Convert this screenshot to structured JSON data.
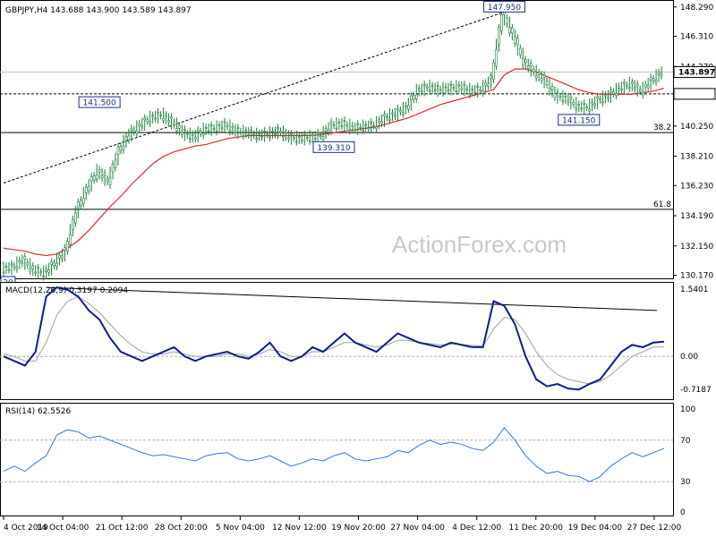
{
  "chart_data": [
    {
      "type": "candlestick",
      "title": "GBPJPY,H4 143.688 143.900 143.589 143.897",
      "watermark": "ActionForex.com",
      "current_price": "143.897",
      "current_price_value": 143.897,
      "ylim": [
        129.9,
        148.7
      ],
      "yticks": [
        "148.290",
        "146.310",
        "144.270",
        "142.420",
        "140.250",
        "138.210",
        "136.230",
        "134.190",
        "132.150",
        "130.170"
      ],
      "ytick_values": [
        148.29,
        146.31,
        144.27,
        142.42,
        140.25,
        138.21,
        136.23,
        134.19,
        132.15,
        130.17
      ],
      "xticks": [
        "4 Oct 2019",
        "14 Oct 04:00",
        "21 Oct 12:00",
        "28 Oct 20:00",
        "5 Nov 04:00",
        "12 Nov 12:00",
        "19 Nov 20:00",
        "27 Nov 04:00",
        "4 Dec 12:00",
        "11 Dec 20:00",
        "19 Dec 04:00",
        "27 Dec 12:00"
      ],
      "ma_color": "#e4292b",
      "candle_color": "#1a7f3a",
      "label_color": "#1a2f8a",
      "price_series": [
        130.6,
        130.7,
        131.2,
        130.5,
        130.3,
        131.0,
        131.8,
        134.5,
        136.0,
        137.2,
        136.5,
        138.6,
        139.7,
        140.3,
        140.8,
        141.0,
        140.5,
        139.8,
        139.5,
        140.0,
        140.1,
        140.3,
        139.9,
        139.8,
        139.6,
        139.7,
        139.9,
        139.5,
        139.4,
        139.5,
        139.6,
        140.3,
        140.4,
        140.1,
        140.2,
        140.3,
        140.8,
        141.1,
        141.5,
        142.6,
        142.9,
        142.7,
        142.8,
        142.9,
        142.6,
        142.7,
        143.4,
        147.9,
        146.4,
        144.6,
        143.9,
        143.3,
        142.3,
        142.1,
        141.6,
        141.5,
        142.0,
        142.3,
        142.8,
        143.1,
        142.6,
        143.3,
        143.9
      ],
      "ma_series": [
        132.0,
        131.9,
        131.8,
        131.6,
        131.5,
        131.6,
        132.0,
        132.5,
        133.2,
        134.0,
        134.8,
        135.5,
        136.3,
        137.0,
        137.7,
        138.2,
        138.5,
        138.7,
        138.9,
        139.0,
        139.2,
        139.4,
        139.5,
        139.6,
        139.6,
        139.6,
        139.6,
        139.6,
        139.6,
        139.6,
        139.7,
        139.8,
        139.9,
        140.0,
        140.1,
        140.2,
        140.4,
        140.6,
        140.8,
        141.1,
        141.4,
        141.7,
        141.9,
        142.1,
        142.3,
        142.5,
        142.7,
        143.7,
        144.1,
        144.1,
        143.9,
        143.6,
        143.3,
        143.0,
        142.7,
        142.5,
        142.4,
        142.4,
        142.4,
        142.4,
        142.5,
        142.6,
        142.8
      ],
      "trendline": {
        "start": 136.4,
        "end": 147.95
      },
      "hlines": [
        {
          "label": "",
          "value": 143.897
        },
        {
          "label": "",
          "value": 142.42
        },
        {
          "label": "38.2",
          "value": 139.81
        },
        {
          "label": "61.8",
          "value": 134.62
        }
      ],
      "annotations": [
        {
          "text": "147.950",
          "value": 147.95
        },
        {
          "text": "141.500",
          "value": 141.5
        },
        {
          "text": "141.150",
          "value": 141.15
        },
        {
          "text": "139.310",
          "value": 139.31
        },
        {
          "text": "20",
          "value": 130.2
        }
      ]
    },
    {
      "type": "line",
      "title": "MACD(12,26,9) 0.3197 0.2094",
      "ylim": [
        -0.95,
        1.6
      ],
      "yticks": [
        "1.5401",
        "0.00",
        "0.00",
        "-0.7187"
      ],
      "ytick_values": [
        1.5401,
        0.0,
        0.0,
        -0.7187
      ],
      "macd_color": "#0b1e8c",
      "signal_color": "#a0a0a0",
      "macd_series": [
        0.0,
        -0.1,
        -0.2,
        0.1,
        1.3,
        1.5,
        1.45,
        1.3,
        1.0,
        0.8,
        0.4,
        0.1,
        0.0,
        -0.1,
        0.0,
        0.1,
        0.2,
        0.0,
        -0.1,
        0.0,
        0.05,
        0.1,
        0.0,
        -0.05,
        0.1,
        0.3,
        0.0,
        -0.1,
        0.0,
        0.2,
        0.1,
        0.3,
        0.5,
        0.3,
        0.2,
        0.1,
        0.3,
        0.5,
        0.4,
        0.3,
        0.25,
        0.2,
        0.3,
        0.25,
        0.2,
        0.2,
        1.2,
        1.1,
        0.7,
        0.0,
        -0.5,
        -0.65,
        -0.6,
        -0.7,
        -0.72,
        -0.6,
        -0.5,
        -0.2,
        0.1,
        0.25,
        0.2,
        0.3,
        0.32
      ],
      "signal_series": [
        0.05,
        0.0,
        -0.1,
        -0.1,
        0.3,
        0.9,
        1.2,
        1.3,
        1.15,
        0.95,
        0.7,
        0.45,
        0.25,
        0.1,
        0.05,
        0.05,
        0.1,
        0.05,
        0.0,
        0.0,
        0.0,
        0.05,
        0.05,
        0.0,
        0.05,
        0.15,
        0.1,
        0.0,
        0.0,
        0.1,
        0.1,
        0.2,
        0.3,
        0.3,
        0.25,
        0.2,
        0.25,
        0.35,
        0.35,
        0.3,
        0.28,
        0.25,
        0.27,
        0.26,
        0.24,
        0.22,
        0.6,
        0.85,
        0.8,
        0.5,
        0.1,
        -0.2,
        -0.4,
        -0.5,
        -0.55,
        -0.6,
        -0.55,
        -0.4,
        -0.2,
        0.0,
        0.1,
        0.2,
        0.21
      ],
      "trendline": {
        "start": 1.5,
        "end": 1.0
      }
    },
    {
      "type": "line",
      "title": "RSI(14) 62.5526",
      "ylim": [
        0,
        100
      ],
      "yticks": [
        "100",
        "70",
        "30",
        "0"
      ],
      "ytick_values": [
        100,
        70,
        30,
        0
      ],
      "rsi_color": "#2b7bd6",
      "levels": [
        70,
        30
      ],
      "rsi_series": [
        40,
        45,
        40,
        48,
        55,
        75,
        80,
        78,
        72,
        74,
        70,
        66,
        62,
        58,
        55,
        56,
        54,
        52,
        50,
        55,
        57,
        58,
        52,
        50,
        52,
        55,
        50,
        45,
        48,
        52,
        50,
        55,
        58,
        52,
        50,
        52,
        54,
        60,
        58,
        65,
        70,
        66,
        68,
        66,
        62,
        60,
        68,
        82,
        70,
        55,
        45,
        38,
        40,
        36,
        35,
        30,
        35,
        45,
        52,
        58,
        54,
        58,
        62
      ]
    }
  ]
}
